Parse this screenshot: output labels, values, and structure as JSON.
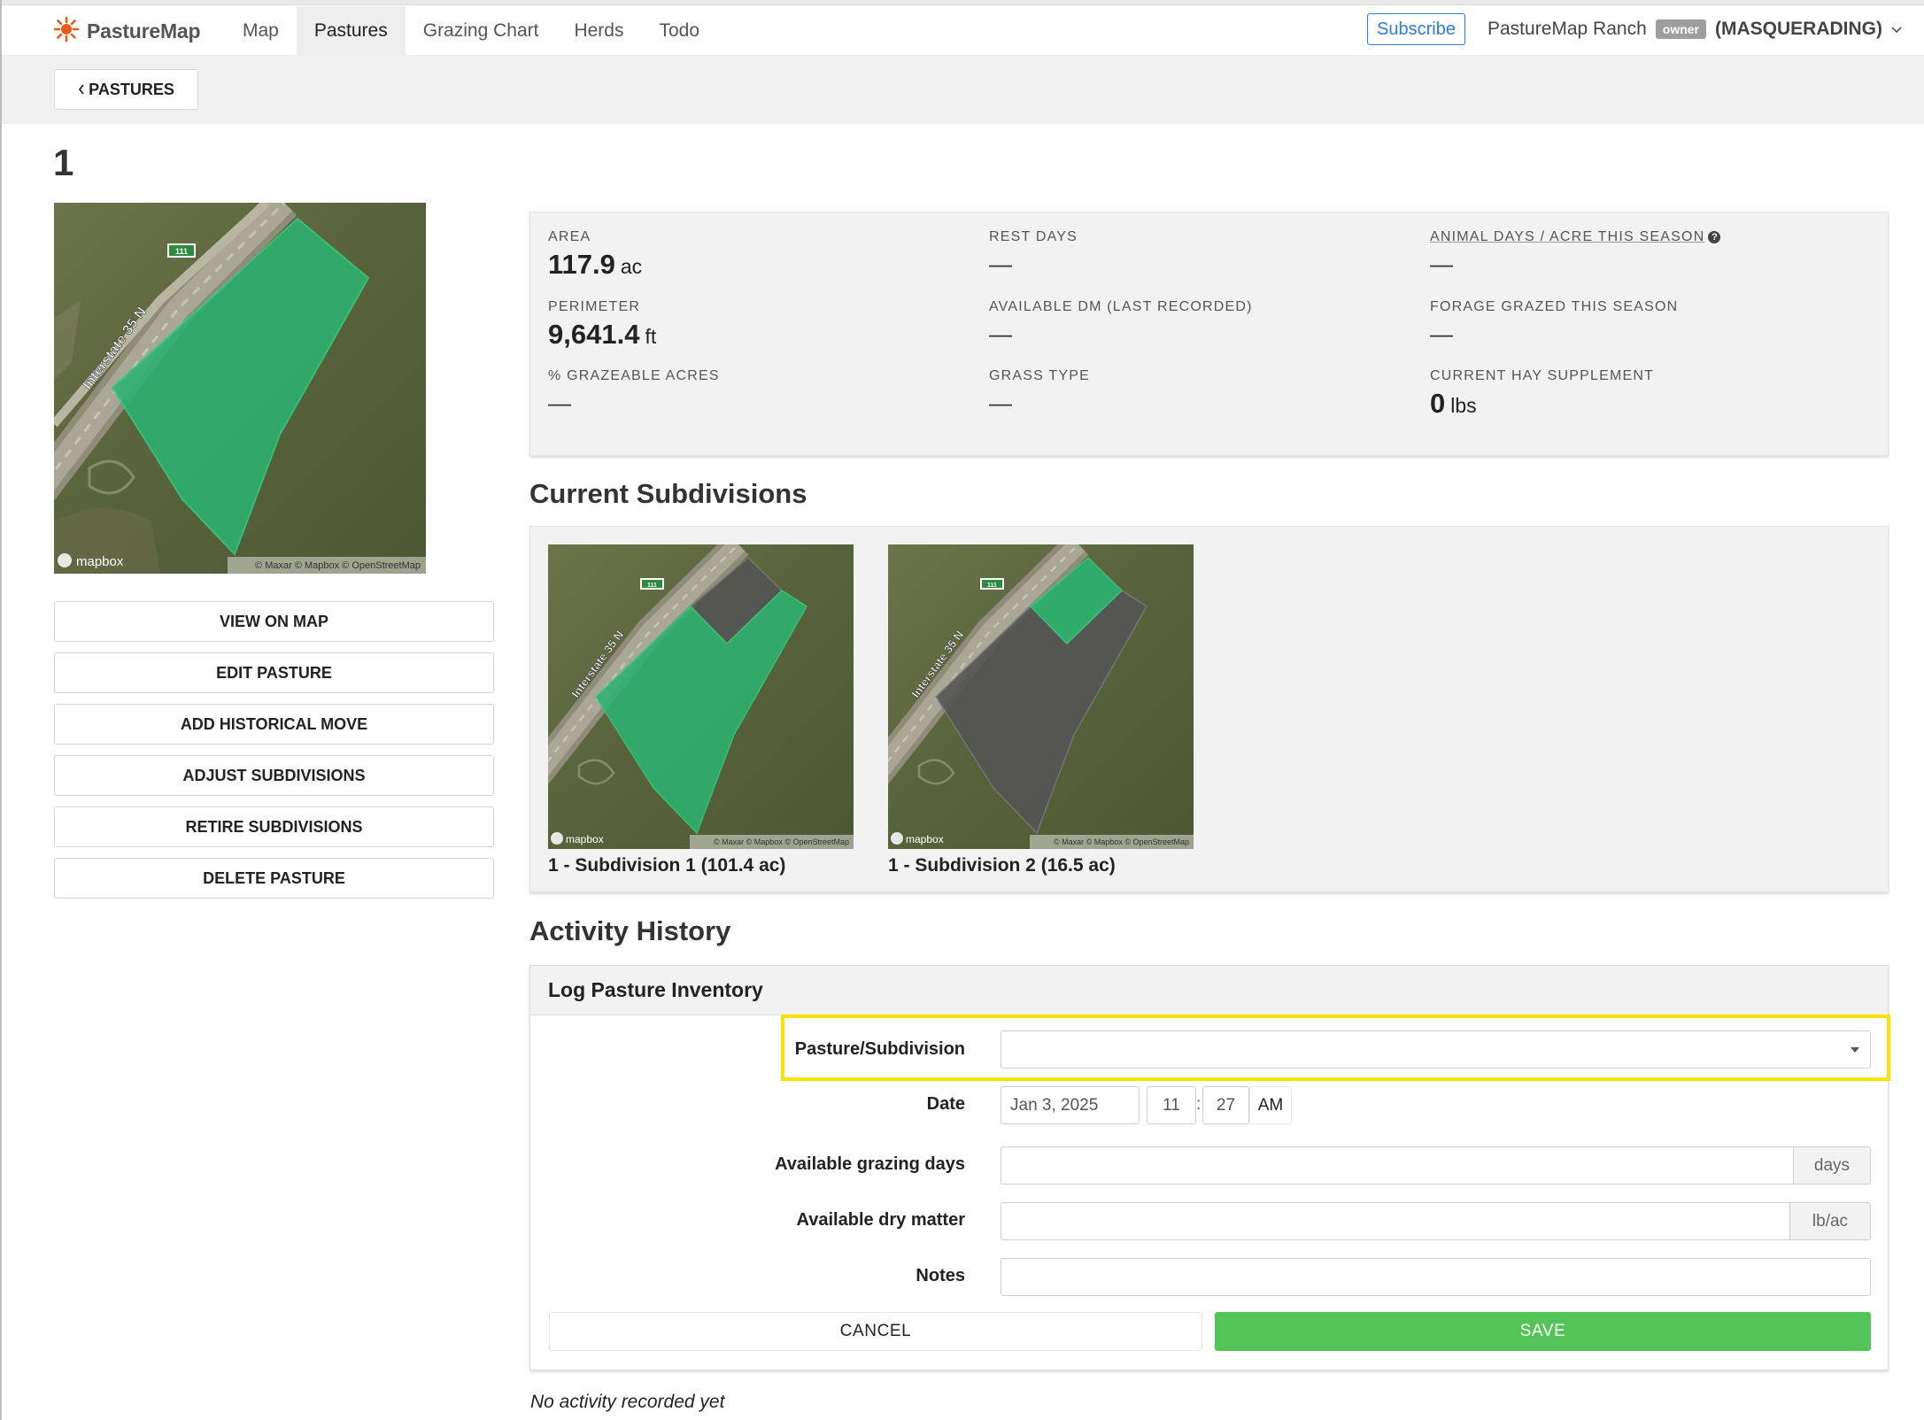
{
  "app": {
    "name": "PastureMap",
    "logo_icon": "sun-icon",
    "accent": "#e8591a"
  },
  "nav": {
    "links": [
      "Map",
      "Pastures",
      "Grazing Chart",
      "Herds",
      "Todo"
    ],
    "active": "Pastures",
    "subscribe": "Subscribe",
    "ranch": "PastureMap Ranch",
    "role_badge": "owner",
    "masquerade": "(MASQUERADING)",
    "dropdown_icon": "chevron-down-icon"
  },
  "back_button": {
    "label": "PASTURES",
    "icon": "chevron-left-icon"
  },
  "pasture": {
    "title": "1"
  },
  "map_attribution": {
    "left": "mapbox",
    "right": "© Maxar © Mapbox © OpenStreetMap"
  },
  "map_labels": {
    "road": "Interstate 35 N",
    "shield": "111"
  },
  "side_buttons": [
    "VIEW ON MAP",
    "EDIT PASTURE",
    "ADD HISTORICAL MOVE",
    "ADJUST SUBDIVISIONS",
    "RETIRE SUBDIVISIONS",
    "DELETE PASTURE"
  ],
  "stats": {
    "area": {
      "label": "AREA",
      "value": "117.9",
      "unit": "ac"
    },
    "rest_days": {
      "label": "REST DAYS",
      "value": "—"
    },
    "animal_days": {
      "label": "ANIMAL DAYS / ACRE THIS SEASON",
      "value": "—",
      "help_icon": "question-circle-icon"
    },
    "perimeter": {
      "label": "PERIMETER",
      "value": "9,641.4",
      "unit": "ft"
    },
    "available_dm": {
      "label": "AVAILABLE DM (LAST RECORDED)",
      "value": "—"
    },
    "forage_grazed": {
      "label": "FORAGE GRAZED THIS SEASON",
      "value": "—"
    },
    "grazeable": {
      "label": "% GRAZEABLE ACRES",
      "value": "—"
    },
    "grass_type": {
      "label": "GRASS TYPE",
      "value": "—"
    },
    "hay": {
      "label": "CURRENT HAY SUPPLEMENT",
      "value": "0",
      "unit": "lbs"
    }
  },
  "subdivisions": {
    "heading": "Current Subdivisions",
    "items": [
      {
        "label": "1 - Subdivision 1 (101.4 ac)"
      },
      {
        "label": "1 - Subdivision 2 (16.5 ac)"
      }
    ]
  },
  "activity": {
    "heading": "Activity History",
    "form": {
      "title": "Log Pasture Inventory",
      "pasture_label": "Pasture/Subdivision",
      "pasture_value": "",
      "date_label": "Date",
      "date_value": "Jan 3, 2025",
      "hour": "11",
      "minute": "27",
      "ampm": "AM",
      "grazing_label": "Available grazing days",
      "grazing_value": "",
      "grazing_unit": "days",
      "dm_label": "Available dry matter",
      "dm_value": "",
      "dm_unit": "lb/ac",
      "notes_label": "Notes",
      "notes_value": "",
      "cancel": "CANCEL",
      "save": "SAVE"
    },
    "empty": "No activity recorded yet"
  },
  "colors": {
    "pasture_fill": "#2db36f",
    "subdiv_dim": "#555555",
    "save_green": "#54c358",
    "highlight": "#f5e400",
    "link_blue": "#2f7fd1"
  }
}
